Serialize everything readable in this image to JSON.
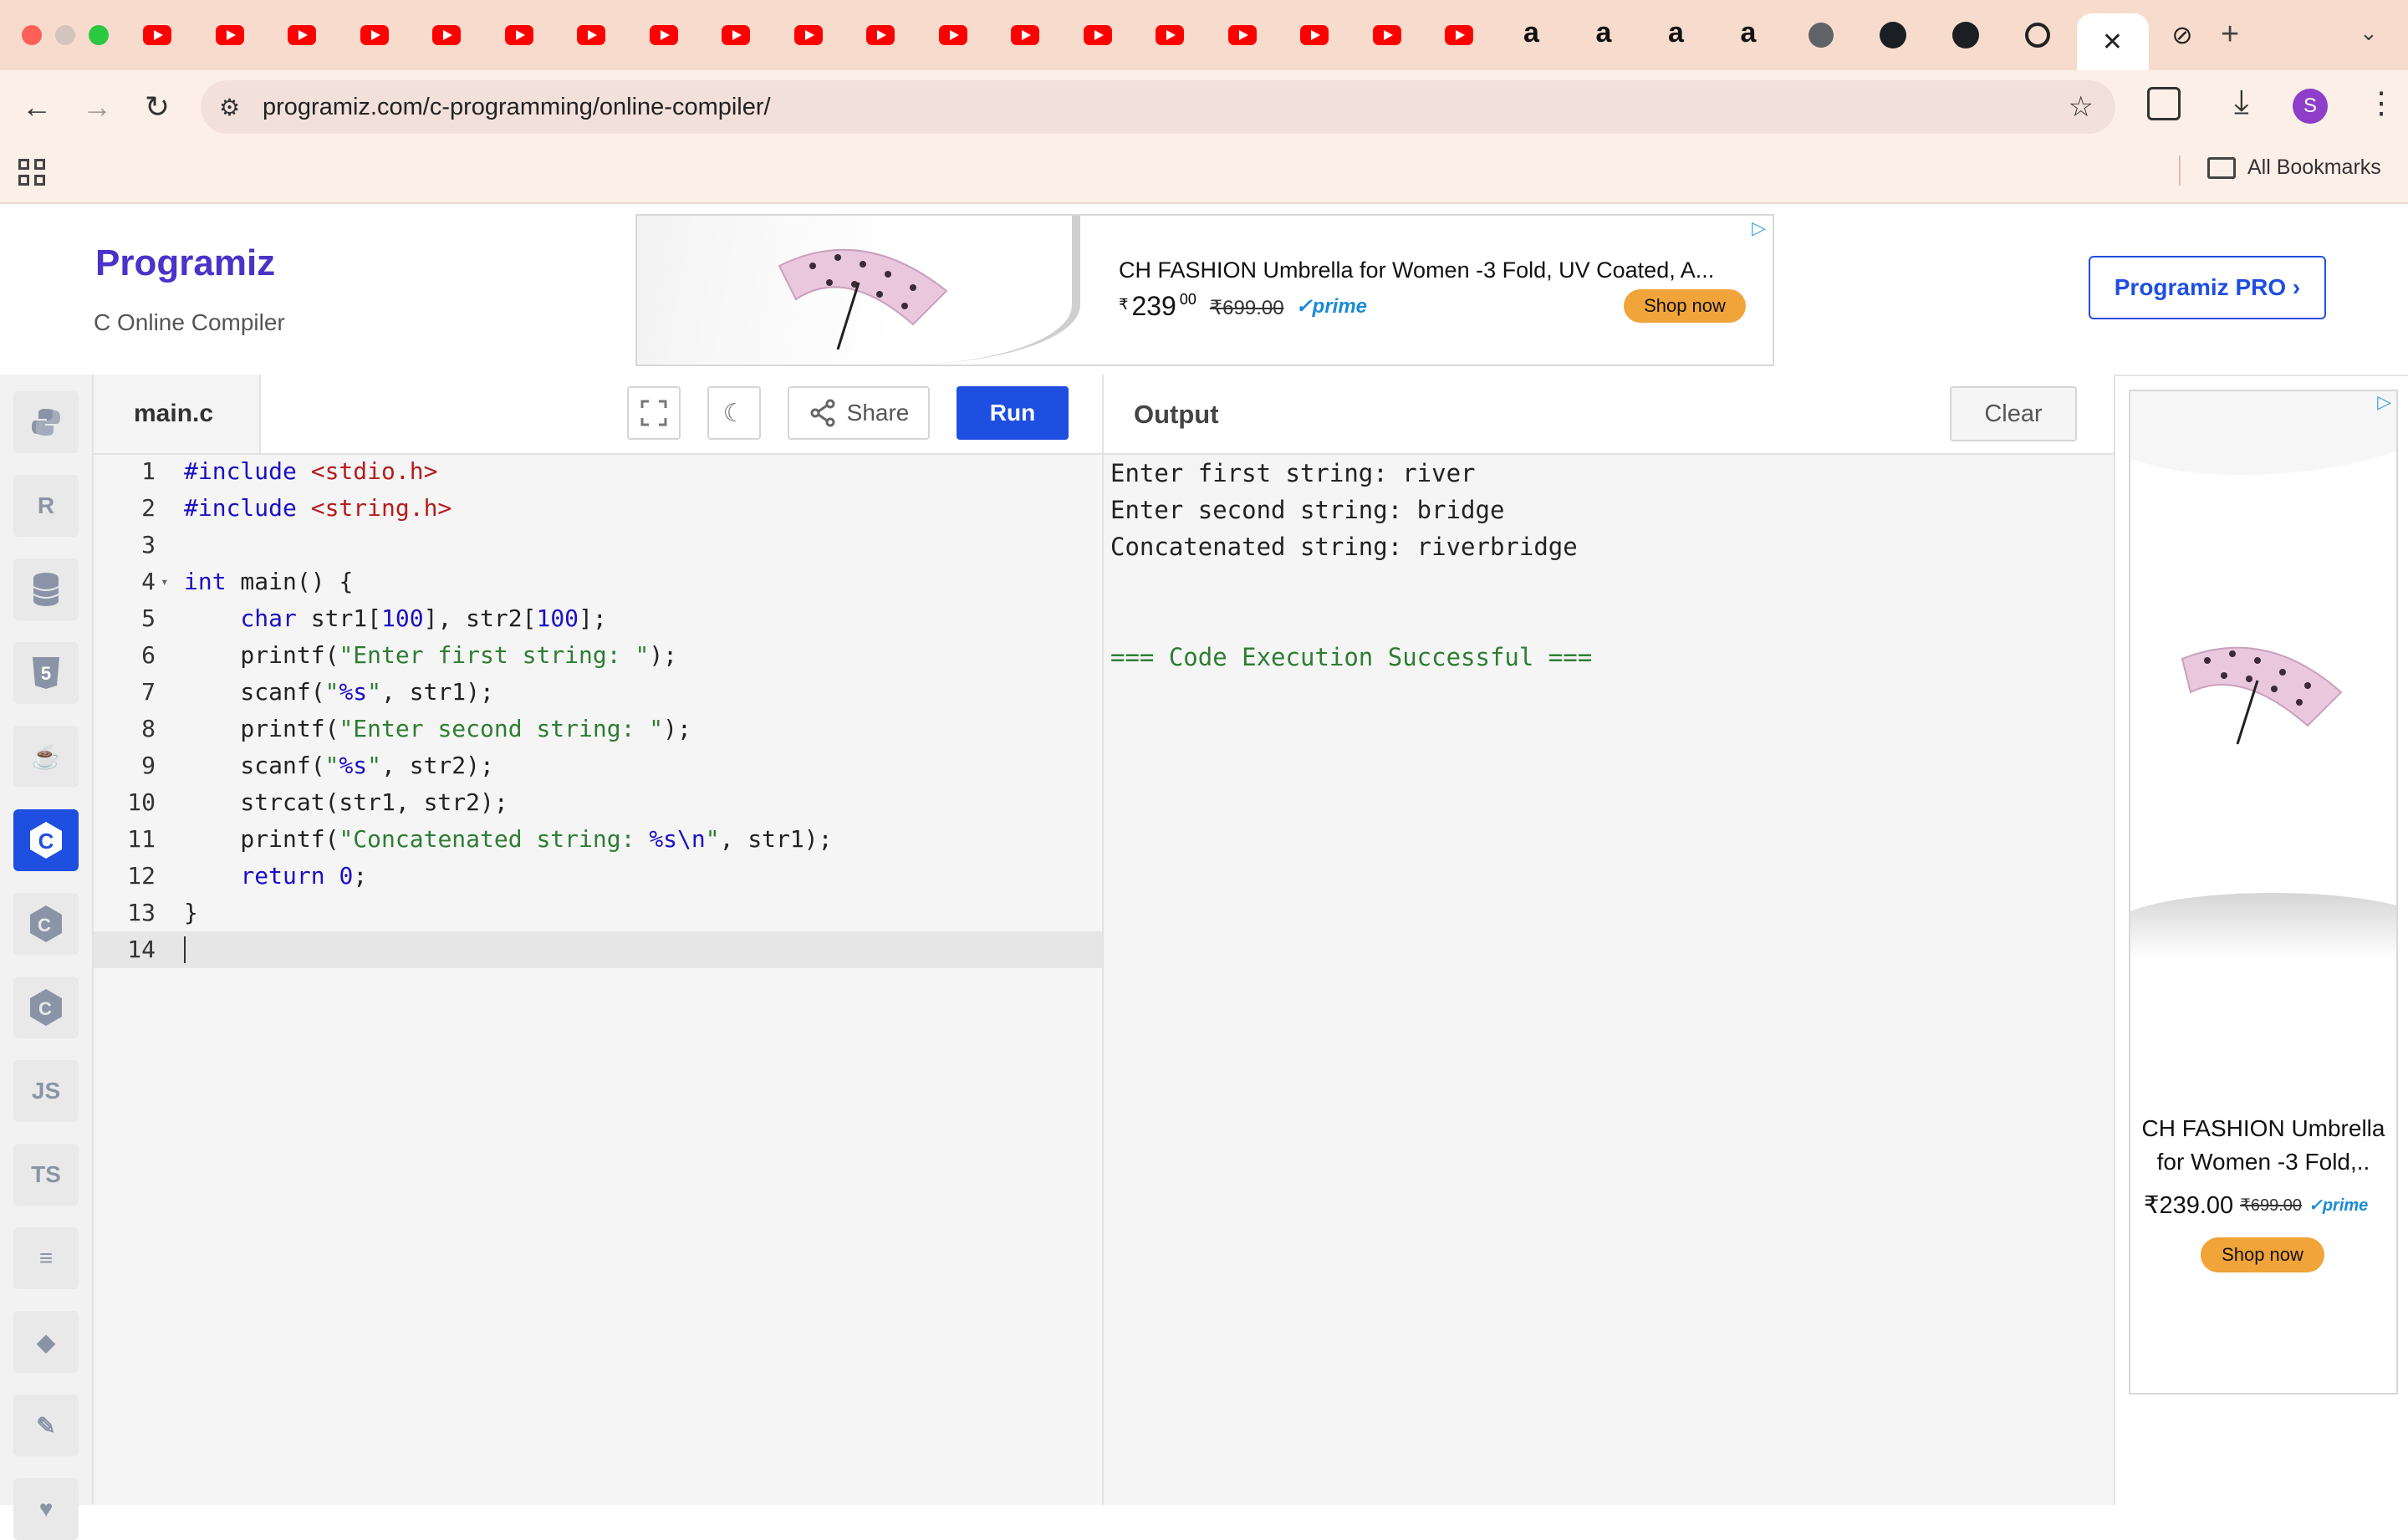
{
  "browser": {
    "tabs": [
      "youtube",
      "youtube",
      "youtube",
      "youtube",
      "youtube",
      "youtube",
      "youtube",
      "youtube",
      "youtube",
      "youtube",
      "youtube",
      "youtube",
      "youtube",
      "youtube",
      "youtube",
      "youtube",
      "youtube",
      "youtube",
      "youtube",
      "amazon",
      "amazon",
      "amazon",
      "amazon",
      "globe",
      "github",
      "github",
      "chatgpt",
      "active-close",
      "compiler"
    ],
    "url": "programiz.com/c-programming/online-compiler/",
    "bookmarks_label": "All Bookmarks",
    "profile_initial": "S"
  },
  "header": {
    "logo_text": "Programiz",
    "subtitle": "C Online Compiler",
    "pro_button": "Programiz PRO ›"
  },
  "ad_banner": {
    "title": "CH FASHION Umbrella for Women -3 Fold, UV Coated, A...",
    "price_main": "239",
    "price_cents": "00",
    "price_currency": "₹",
    "old_price": "₹699.00",
    "prime": "prime",
    "cta": "Shop now"
  },
  "rail": {
    "items": [
      "python-icon",
      "r-icon",
      "sql-icon",
      "html-icon",
      "java-icon",
      "c-icon",
      "cpp-icon",
      "csharp-icon",
      "js-icon",
      "ts-icon",
      "go-icon",
      "swift-icon",
      "rust-icon",
      "more-icon"
    ],
    "js_label": "JS",
    "ts_label": "TS"
  },
  "editor": {
    "filename": "main.c",
    "share_label": "Share",
    "run_label": "Run",
    "lines": [
      {
        "n": "1",
        "text": "#include <stdio.h>"
      },
      {
        "n": "2",
        "text": "#include <string.h>"
      },
      {
        "n": "3",
        "text": ""
      },
      {
        "n": "4",
        "text": "int main() {"
      },
      {
        "n": "5",
        "text": "    char str1[100], str2[100];"
      },
      {
        "n": "6",
        "text": "    printf(\"Enter first string: \");"
      },
      {
        "n": "7",
        "text": "    scanf(\"%s\", str1);"
      },
      {
        "n": "8",
        "text": "    printf(\"Enter second string: \");"
      },
      {
        "n": "9",
        "text": "    scanf(\"%s\", str2);"
      },
      {
        "n": "10",
        "text": "    strcat(str1, str2);"
      },
      {
        "n": "11",
        "text": "    printf(\"Concatenated string: %s\\n\", str1);"
      },
      {
        "n": "12",
        "text": "    return 0;"
      },
      {
        "n": "13",
        "text": "}"
      },
      {
        "n": "14",
        "text": ""
      }
    ]
  },
  "output": {
    "title": "Output",
    "clear_label": "Clear",
    "lines": [
      "Enter first string: river",
      "Enter second string: bridge",
      "Concatenated string: riverbridge",
      "",
      "",
      "=== Code Execution Successful ==="
    ]
  },
  "side_ad": {
    "title": "CH FASHION Umbrella for Women -3 Fold,..",
    "price": "₹239.00",
    "old_price": "₹699.00",
    "prime": "prime",
    "cta": "Shop now"
  }
}
